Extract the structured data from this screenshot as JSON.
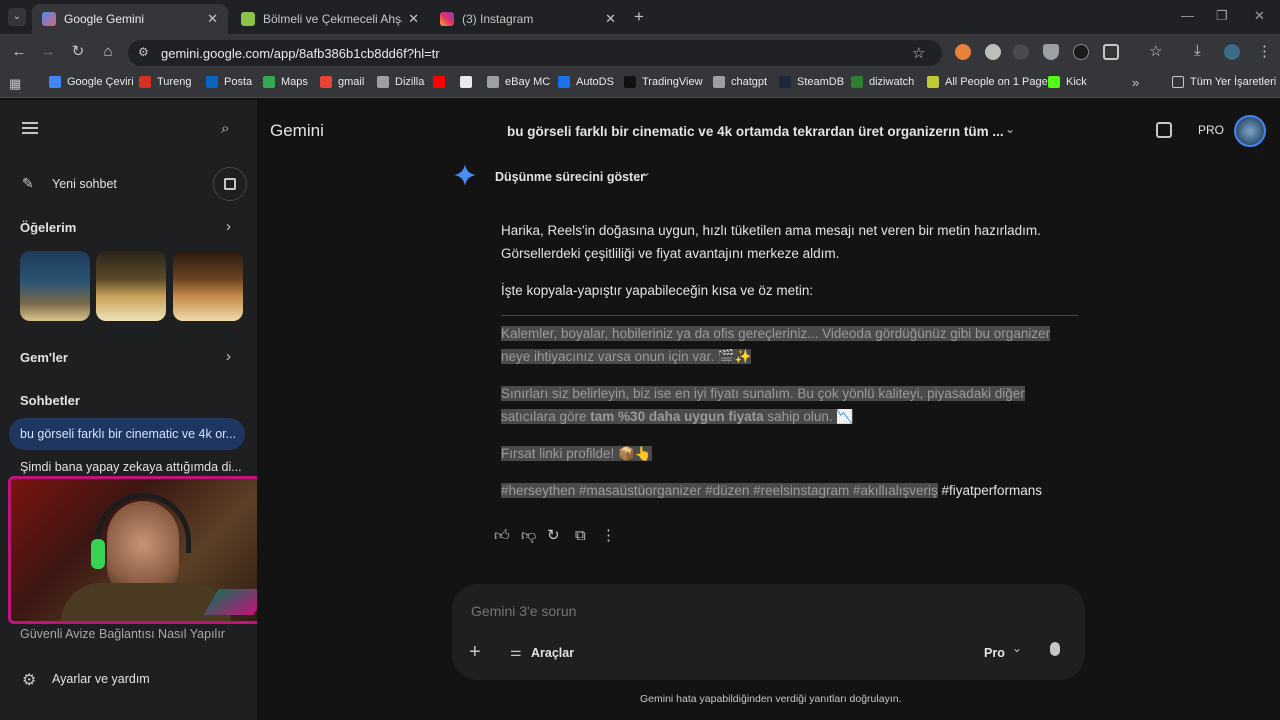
{
  "browser": {
    "tabs": [
      {
        "title": "Google Gemini",
        "active": true
      },
      {
        "title": "Bölmeli ve Çekmeceli Ahşap Or",
        "active": false
      },
      {
        "title": "(3) Instagram",
        "active": false
      }
    ],
    "new_tab_label": "+",
    "url": "gemini.google.com/app/8afb386b1cb8dd6f?hl=tr",
    "bookmarks": [
      {
        "label": "Google Çeviri",
        "color": "#4285f4"
      },
      {
        "label": "Tureng",
        "color": "#d93025"
      },
      {
        "label": "Posta",
        "color": "#0a66c2"
      },
      {
        "label": "Maps",
        "color": "#34a853"
      },
      {
        "label": "gmail",
        "color": "#ea4335"
      },
      {
        "label": "Dizilla",
        "color": "#9aa0a6"
      },
      {
        "label": "",
        "color": "#ff0000"
      },
      {
        "label": "",
        "color": "#e8eaed"
      },
      {
        "label": "eBay MC",
        "color": "#9aa0a6"
      },
      {
        "label": "AutoDS",
        "color": "#1a73e8"
      },
      {
        "label": "TradingView",
        "color": "#111111"
      },
      {
        "label": "chatgpt",
        "color": "#9aa0a6"
      },
      {
        "label": "SteamDB",
        "color": "#1b2838"
      },
      {
        "label": "diziwatch",
        "color": "#2e7d32"
      },
      {
        "label": "All People on 1 Page",
        "color": "#c0ca33"
      },
      {
        "label": "Kick",
        "color": "#53fc18"
      }
    ],
    "all_bookmarks_label": "Tüm Yer İşaretleri"
  },
  "sidebar": {
    "new_chat_label": "Yeni sohbet",
    "my_items_label": "Öğelerim",
    "gems_label": "Gem'ler",
    "chats_label": "Sohbetler",
    "chats": [
      "bu görseli farklı bir cinematic ve 4k or...",
      "Şimdi bana yapay zekaya attığımda di...",
      "Güvenli Avize Bağlantısı Nasıl Yapılır"
    ],
    "settings_label": "Ayarlar ve yardım"
  },
  "header": {
    "app_name": "Gemini",
    "conversation_title": "bu görseli farklı bir cinematic ve 4k ortamda tekrardan üret organizerın tüm ...",
    "pro_badge": "PRO"
  },
  "response": {
    "thinking_toggle": "Düşünme sürecini göster",
    "intro_line1": "Harika, Reels'in doğasına uygun, hızlı tüketilen ama mesajı net veren bir metin hazırladım.",
    "intro_line2": "Görsellerdeki çeşitliliği ve fiyat avantajını merkeze aldım.",
    "lead": "İşte kopyala-yapıştır yapabileceğin kısa ve öz metin:",
    "p1_line1": "Kalemler, boyalar, hobileriniz ya da ofis gereçleriniz... Videoda gördüğünüz gibi bu organizer",
    "p1_line2": "neye ihtiyacınız varsa onun için var. 🎬✨",
    "p2_line1": "Sınırları siz belirleyin, biz ise en iyi fiyatı sunalım. Bu çok yönlü kaliteyi, piyasadaki diğer",
    "p2_pre": "satıcılara göre ",
    "p2_bold": "tam %30 daha uygun fiyata",
    "p2_post": " sahip olun. 📉",
    "p3": "Fırsat linki profilde! 📦👆",
    "hashtags_selected": "#herseythen #masaüstüorganizer #düzen #reelsinstagram #akıllıalışveriş",
    "hashtags_rest": " #fiyatperformans"
  },
  "composer": {
    "placeholder": "Gemini 3'e sorun",
    "tools_label": "Araçlar",
    "model_label": "Pro"
  },
  "footer_note": "Gemini hata yapabildiğinden verdiği yanıtları doğrulayın.",
  "colors": {
    "accent": "#1f3760",
    "gemini_star": "#4a8cf5",
    "highlight": "#4a4a4a",
    "webcam_frame": "#c0147b"
  }
}
